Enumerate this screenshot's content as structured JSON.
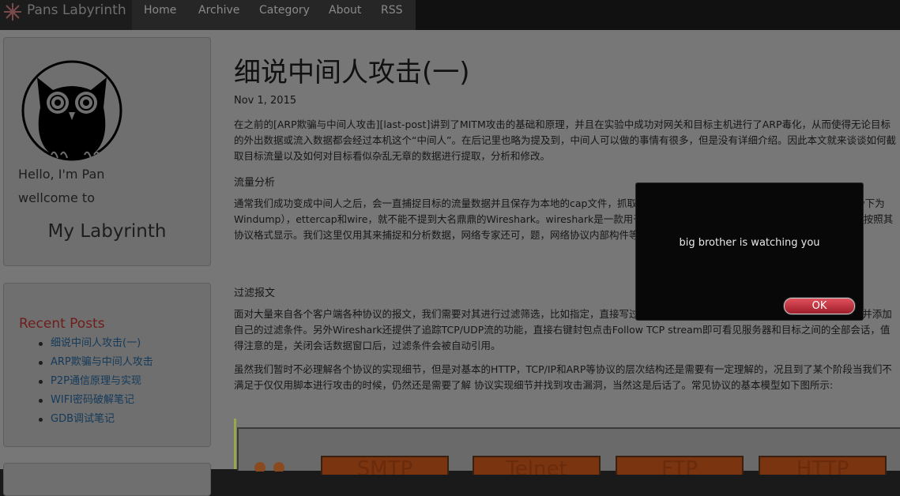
{
  "navbar": {
    "brand": "Pans Labyrinth",
    "items": [
      "Home",
      "Archive",
      "Category",
      "About",
      "RSS"
    ]
  },
  "sidebar": {
    "greeting": "Hello, I'm Pan",
    "welcome": "wellcome to",
    "site_name": "My Labyrinth",
    "recent_heading": "Recent Posts",
    "recent_posts": [
      "细说中间人攻击(一)",
      "ARP欺骗与中间人攻击",
      "P2P通信原理与实现",
      "WIFI密码破解笔记",
      "GDB调试笔记"
    ]
  },
  "article": {
    "title": "细说中间人攻击(一)",
    "date": "Nov 1, 2015",
    "p1": "在之前的[ARP欺骗与中间人攻击][last-post]讲到了MITM攻击的基础和原理，并且在实验中成功对网关和目标主机进行了ARP毒化，从而使得无论目标的外出数据或流入数据都会经过本机这个“中间人”。在后记里也略为提及到，中间人可以做的事情有很多，但是没有详细介绍。因此本文就来谈谈如何截取目标流量以及如何对目标看似杂乱无章的数据进行提取，分析和修改。",
    "h1": "流量分析",
    "p2": "通常我们成功变成中间人之后，会一直捕捉目标的流量数据并且保存为本地的cap文件，抓取的方式有很多，比如Linux下的tcpdump（Window下为Windump），ettercap和wire，就不能不提到大名鼎鼎的Wireshark。wireshark是一款用于网络封包的协议分析的开源工具，流量 数据，并且按照其协议格式显示。我们这里仅用其来捕捉和分析数据，网络专家还可，题，网络协议内部构件等等。",
    "h2": "过滤报文",
    "p3": "面对大量来自各个客户端各种协议的报文，我们需要对其进行过滤筛选，比如指定，直接写过滤条件，或者在Analyze->Display Filter里面定义并添加自己的过滤条件。另外Wireshark还提供了追踪TCP/UDP流的功能，直接右键封包点击Follow TCP stream即可看见服务器和目标之间的全部会话，值得注意的是，关闭会话数据窗口后，过滤条件会被自动引用。",
    "p4": "虽然我们暂时不必理解各个协议的实现细节，但是对基本的HTTP，TCP/IP和ARP等协议的层次结构还是需要有一定理解的，况且到了某个阶段当我们不满足于仅仅用脚本进行攻击的时候，仍然还是需要了解 协议实现细节并找到攻击漏洞，当然这是后话了。常见协议的基本模型如下图所示:",
    "figure_labels": [
      "SMTP",
      "Telnet",
      "FTP",
      "HTTP"
    ]
  },
  "dialog": {
    "message": "big brother is watching you",
    "ok_label": "OK"
  }
}
